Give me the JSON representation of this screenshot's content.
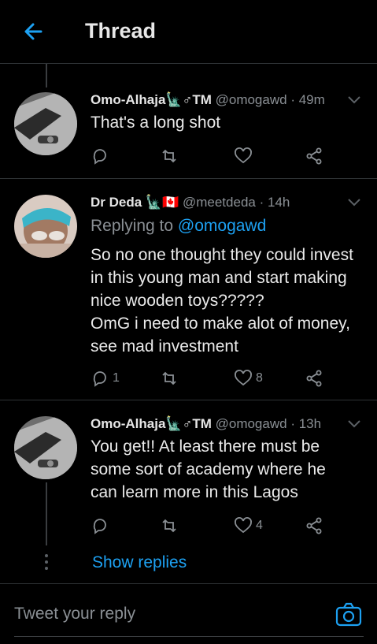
{
  "header": {
    "title": "Thread"
  },
  "tweets": [
    {
      "name": "Omo-Alhaja🗽♂TM",
      "handle": "@omogawd",
      "time": "49m",
      "text": "That's a long shot",
      "reply_count": "",
      "like_count": ""
    },
    {
      "name": "Dr Deda 🗽🇨🇦",
      "handle": "@meetdeda",
      "time": "14h",
      "replying_prefix": "Replying to",
      "replying_to": "@omogawd",
      "lines": [
        "So no one thought they could invest",
        "in this young man and start making",
        "nice wooden toys?????",
        "OmG i need to make alot of money,",
        "see mad investment"
      ],
      "reply_count": "1",
      "like_count": "8"
    },
    {
      "name": "Omo-Alhaja🗽♂TM",
      "handle": "@omogawd",
      "time": "13h",
      "lines": [
        "You get!! At least there must be",
        "some sort of academy where he",
        "can learn more in this Lagos"
      ],
      "reply_count": "",
      "like_count": "4"
    }
  ],
  "show_replies": "Show replies",
  "reply_bar": {
    "placeholder": "Tweet your reply"
  },
  "colors": {
    "accent": "#1da1f2",
    "background": "#000000",
    "muted": "#8a8f94",
    "divider": "#2f3336"
  },
  "icons": [
    "back-arrow-icon",
    "reply-icon",
    "retweet-icon",
    "like-icon",
    "share-icon",
    "chevron-down-icon",
    "camera-icon"
  ]
}
